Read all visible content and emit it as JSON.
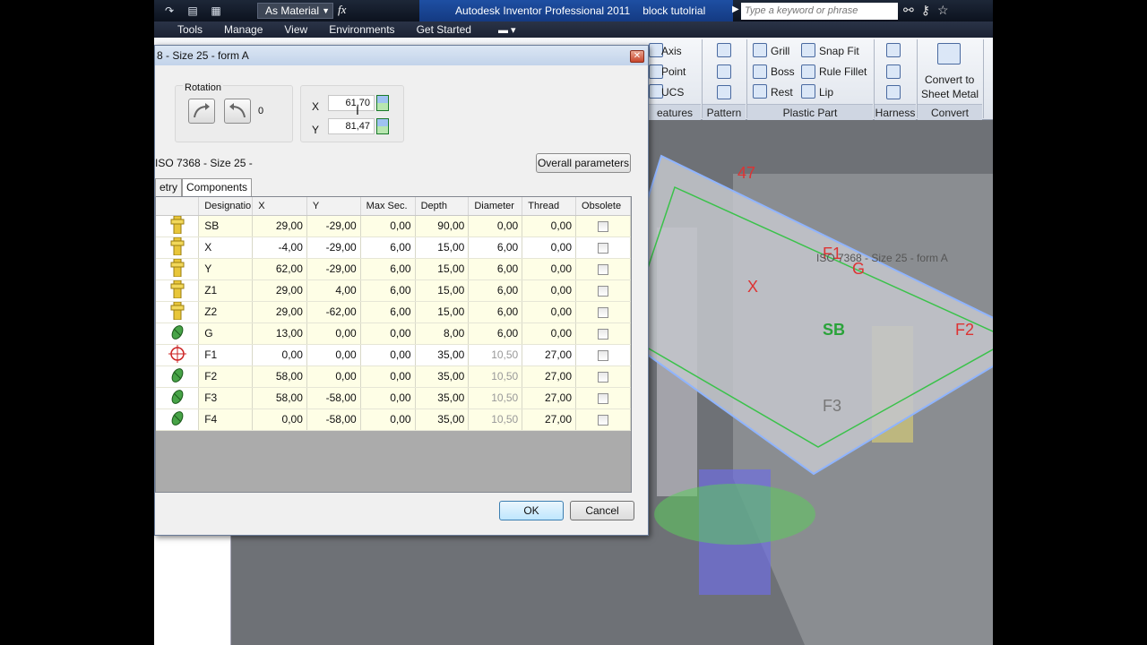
{
  "app": {
    "title": "Autodesk Inventor Professional 2011",
    "document": "block tutolrial",
    "material_select": "As Material",
    "search_placeholder": "Type a keyword or phrase"
  },
  "menubar": [
    "Tools",
    "Manage",
    "View",
    "Environments",
    "Get Started"
  ],
  "ribbon": {
    "work_features": {
      "items": [
        "Axis",
        "Point",
        "UCS"
      ],
      "label": "eatures"
    },
    "pattern": {
      "label": "Pattern"
    },
    "plastic_part": {
      "items": [
        "Grill",
        "Snap Fit",
        "Boss",
        "Rule Fillet",
        "Rest",
        "Lip"
      ],
      "label": "Plastic Part"
    },
    "harness": {
      "label": "Harness"
    },
    "convert": {
      "button_line1": "Convert to",
      "button_line2": "Sheet Metal",
      "label": "Convert"
    }
  },
  "dialog": {
    "title": "8 - Size 25 - form A",
    "rotation_label": "Rotation",
    "rotation_value": "0",
    "x_label": "X",
    "x_value": "61,70",
    "y_label": "Y",
    "y_value": "81,47",
    "iso_label": "ISO 7368 - Size 25 -",
    "overall_parameters": "Overall parameters",
    "tabs": [
      "etry",
      "Components"
    ],
    "columns": [
      "Designatio",
      "X",
      "Y",
      "Max Sec.",
      "Depth",
      "Diameter",
      "Thread",
      "Obsolete"
    ],
    "rows": [
      {
        "icon": "yellow-pin",
        "name": "SB",
        "x": "29,00",
        "y": "-29,00",
        "max": "0,00",
        "depth": "90,00",
        "dia": "0,00",
        "thread": "0,00",
        "white": false,
        "grey": false
      },
      {
        "icon": "yellow-pin",
        "name": "X",
        "x": "-4,00",
        "y": "-29,00",
        "max": "6,00",
        "depth": "15,00",
        "dia": "6,00",
        "thread": "0,00",
        "white": true,
        "grey": false
      },
      {
        "icon": "yellow-pin",
        "name": "Y",
        "x": "62,00",
        "y": "-29,00",
        "max": "6,00",
        "depth": "15,00",
        "dia": "6,00",
        "thread": "0,00",
        "white": false,
        "grey": false
      },
      {
        "icon": "yellow-pin",
        "name": "Z1",
        "x": "29,00",
        "y": "4,00",
        "max": "6,00",
        "depth": "15,00",
        "dia": "6,00",
        "thread": "0,00",
        "white": false,
        "grey": false
      },
      {
        "icon": "yellow-pin",
        "name": "Z2",
        "x": "29,00",
        "y": "-62,00",
        "max": "6,00",
        "depth": "15,00",
        "dia": "6,00",
        "thread": "0,00",
        "white": false,
        "grey": false
      },
      {
        "icon": "green-screw",
        "name": "G",
        "x": "13,00",
        "y": "0,00",
        "max": "0,00",
        "depth": "8,00",
        "dia": "6,00",
        "thread": "0,00",
        "white": false,
        "grey": false
      },
      {
        "icon": "crosshair",
        "name": "F1",
        "x": "0,00",
        "y": "0,00",
        "max": "0,00",
        "depth": "35,00",
        "dia": "10,50",
        "thread": "27,00",
        "white": true,
        "grey": true
      },
      {
        "icon": "green-screw",
        "name": "F2",
        "x": "58,00",
        "y": "0,00",
        "max": "0,00",
        "depth": "35,00",
        "dia": "10,50",
        "thread": "27,00",
        "white": false,
        "grey": true
      },
      {
        "icon": "green-screw",
        "name": "F3",
        "x": "58,00",
        "y": "-58,00",
        "max": "0,00",
        "depth": "35,00",
        "dia": "10,50",
        "thread": "27,00",
        "white": false,
        "grey": true
      },
      {
        "icon": "green-screw",
        "name": "F4",
        "x": "0,00",
        "y": "-58,00",
        "max": "0,00",
        "depth": "35,00",
        "dia": "10,50",
        "thread": "27,00",
        "white": false,
        "grey": true
      }
    ],
    "ok": "OK",
    "cancel": "Cancel"
  },
  "viewport": {
    "labels": [
      {
        "text": "47",
        "color": "#d33"
      },
      {
        "text": "F1",
        "color": "#d33"
      },
      {
        "text": "G",
        "color": "#d33"
      },
      {
        "text": "X",
        "color": "#d33"
      },
      {
        "text": "SB",
        "color": "#2aa33a"
      },
      {
        "text": "F2",
        "color": "#d33"
      },
      {
        "text": "F3",
        "color": "#777"
      },
      {
        "text": "ISO 7368 - Size 25 - form A",
        "color": "#555"
      }
    ]
  }
}
